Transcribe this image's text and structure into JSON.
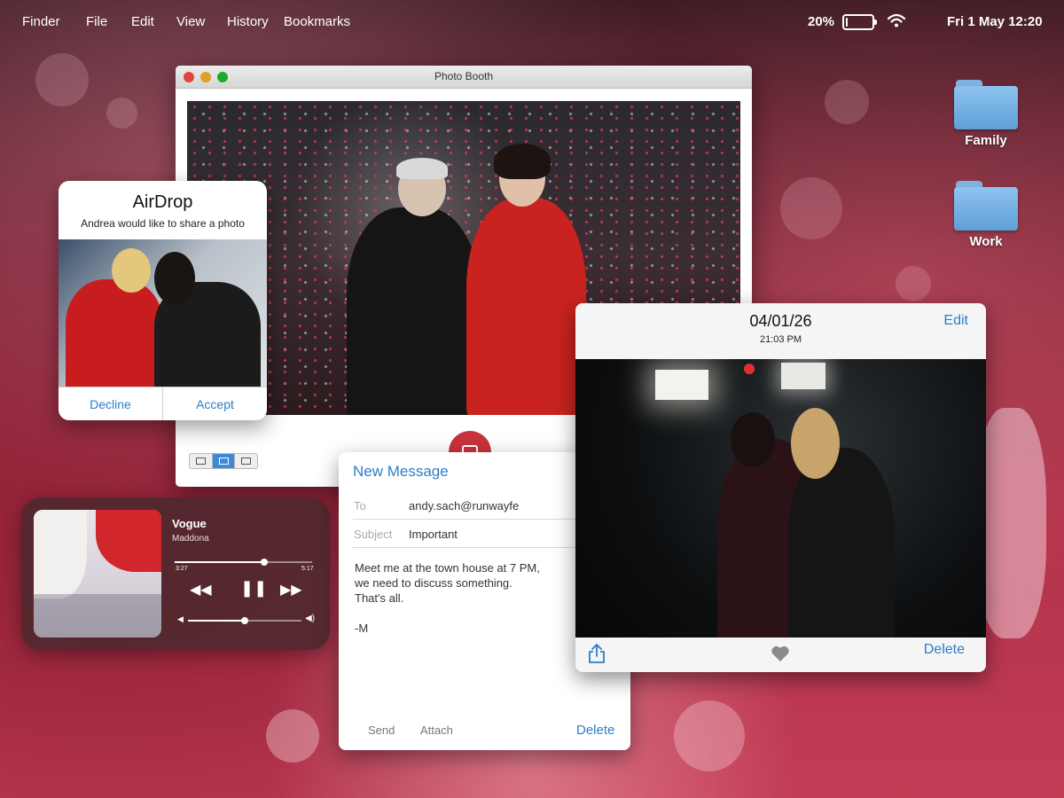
{
  "menubar": {
    "items": [
      "Finder",
      "File",
      "Edit",
      "View",
      "History",
      "Bookmarks"
    ],
    "battery_percent": "20%",
    "battery_level": 0.2,
    "datetime": "Fri 1 May 12:20"
  },
  "desktop": {
    "folders": [
      {
        "label": "Family"
      },
      {
        "label": "Work"
      }
    ]
  },
  "photo_booth": {
    "title": "Photo Booth",
    "view_modes": [
      "grid",
      "single",
      "split"
    ],
    "selected_mode": "single"
  },
  "airdrop": {
    "title": "AirDrop",
    "subtitle": "Andrea would like to share a photo",
    "decline_label": "Decline",
    "accept_label": "Accept"
  },
  "music": {
    "song": "Vogue",
    "artist": "Maddona",
    "elapsed": "3:27",
    "duration": "5:17",
    "progress": 0.65,
    "volume": 0.5
  },
  "message": {
    "header": "New Message",
    "to_label": "To",
    "to_value": "andy.sach@runwayfe",
    "subject_label": "Subject",
    "subject_value": "Important",
    "body_lines": [
      "Meet me at the town house at 7 PM,",
      "we need to discuss something.",
      "That's all.",
      "",
      "-M"
    ],
    "send_label": "Send",
    "attach_label": "Attach",
    "delete_label": "Delete"
  },
  "viewer": {
    "date": "04/01/26",
    "time": "21:03 PM",
    "edit_label": "Edit",
    "delete_label": "Delete"
  },
  "colors": {
    "accent": "#2a7dc8",
    "shutter": "#c8323c"
  }
}
